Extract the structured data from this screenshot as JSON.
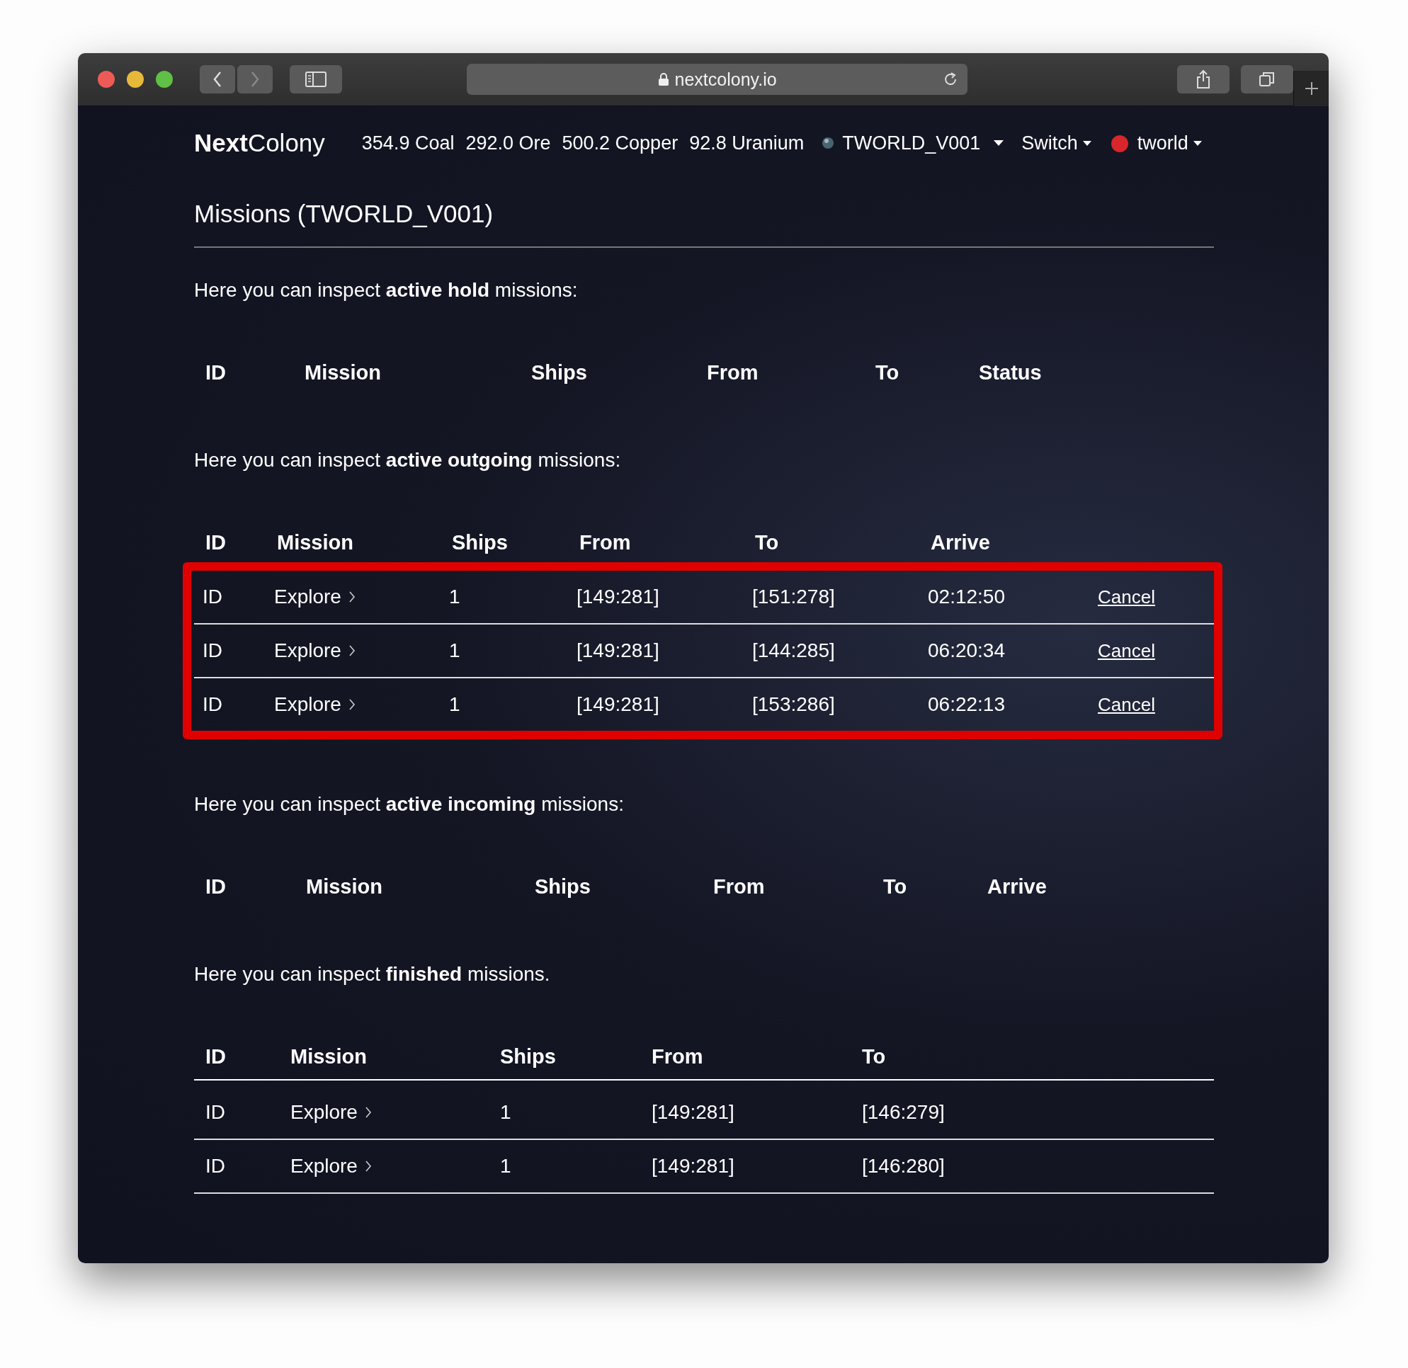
{
  "browser": {
    "url": "nextcolony.io"
  },
  "nav": {
    "logo": "**Next**Colony",
    "resources": [
      "354.9 Coal",
      "292.0 Ore",
      "500.2 Copper",
      "92.8 Uranium"
    ],
    "planet": "TWORLD_V001",
    "switch": "Switch",
    "user": "tworld"
  },
  "page_title": "Missions (TWORLD_V001)",
  "sections": [
    {
      "intro": "Here you can inspect **active hold** missions:",
      "columns": [
        "ID",
        "Mission",
        "Ships",
        "From",
        "To",
        "Status"
      ]
    },
    {
      "intro": "Here you can inspect **active outgoing** missions:",
      "highlighted": true,
      "columns": [
        "ID",
        "Mission",
        "Ships",
        "From",
        "To",
        "Arrive"
      ],
      "rows": [
        {
          "id": "ID",
          "mission": "Explore",
          "ships": "1",
          "from": "[149:281]",
          "to": "[151:278]",
          "arrive": "02:12:50",
          "action": "Cancel"
        },
        {
          "id": "ID",
          "mission": "Explore",
          "ships": "1",
          "from": "[149:281]",
          "to": "[144:285]",
          "arrive": "06:20:34",
          "action": "Cancel"
        },
        {
          "id": "ID",
          "mission": "Explore",
          "ships": "1",
          "from": "[149:281]",
          "to": "[153:286]",
          "arrive": "06:22:13",
          "action": "Cancel"
        }
      ]
    },
    {
      "intro": "Here you can inspect **active incoming** missions:",
      "columns": [
        "ID",
        "Mission",
        "Ships",
        "From",
        "To",
        "Arrive"
      ]
    },
    {
      "intro": "Here you can inspect **finished** missions.",
      "columns": [
        "ID",
        "Mission",
        "Ships",
        "From",
        "To"
      ],
      "rows": [
        {
          "id": "ID",
          "mission": "Explore",
          "ships": "1",
          "from": "[149:281]",
          "to": "[146:279]"
        },
        {
          "id": "ID",
          "mission": "Explore",
          "ships": "1",
          "from": "[149:281]",
          "to": "[146:280]"
        }
      ]
    }
  ]
}
